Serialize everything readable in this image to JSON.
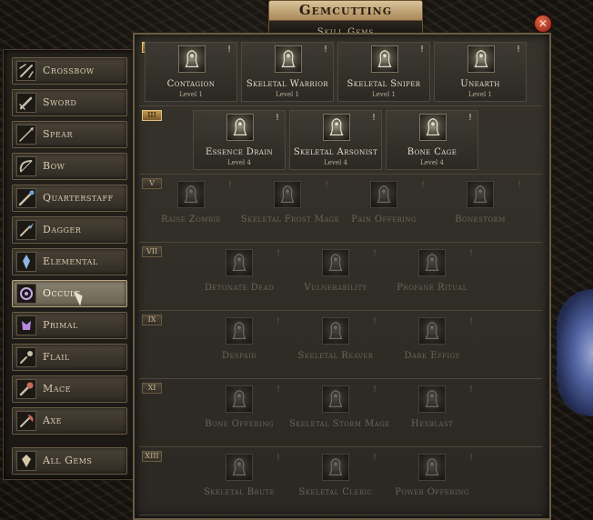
{
  "window": {
    "title": "Gemcutting",
    "subtitle": "Skill Gems",
    "close_symbol": "✕"
  },
  "colors": {
    "accent": "#c59a52",
    "panel": "#37332c",
    "close": "#c13a24",
    "crystal": "#6a7fc4"
  },
  "categories": [
    {
      "label": "Crossbow",
      "icon": "crossbow-icon",
      "active": false
    },
    {
      "label": "Sword",
      "icon": "sword-icon",
      "active": false
    },
    {
      "label": "Spear",
      "icon": "spear-icon",
      "active": false
    },
    {
      "label": "Bow",
      "icon": "bow-icon",
      "active": false
    },
    {
      "label": "Quarterstaff",
      "icon": "quarterstaff-icon",
      "active": false
    },
    {
      "label": "Dagger",
      "icon": "dagger-icon",
      "active": false
    },
    {
      "label": "Elemental",
      "icon": "elemental-icon",
      "active": false
    },
    {
      "label": "Occult",
      "icon": "occult-icon",
      "active": true
    },
    {
      "label": "Primal",
      "icon": "primal-icon",
      "active": false
    },
    {
      "label": "Flail",
      "icon": "flail-icon",
      "active": false
    },
    {
      "label": "Mace",
      "icon": "mace-icon",
      "active": false
    },
    {
      "label": "Axe",
      "icon": "axe-icon",
      "active": false
    }
  ],
  "all_gems": {
    "label": "All Gems",
    "icon": "gem-icon"
  },
  "tiers": [
    {
      "numeral": "I",
      "unlocked": true,
      "gems": [
        {
          "name": "Contagion",
          "level": "Level 1",
          "icon": "contagion-icon"
        },
        {
          "name": "Skeletal Warrior",
          "level": "Level 1",
          "icon": "skeletal-warrior-icon"
        },
        {
          "name": "Skeletal Sniper",
          "level": "Level 1",
          "icon": "skeletal-sniper-icon"
        },
        {
          "name": "Unearth",
          "level": "Level 1",
          "icon": "unearth-icon"
        }
      ]
    },
    {
      "numeral": "III",
      "unlocked": true,
      "gems": [
        {
          "name": "Essence Drain",
          "level": "Level 4",
          "icon": "essence-drain-icon"
        },
        {
          "name": "Skeletal Arsonist",
          "level": "Level 4",
          "icon": "skeletal-arsonist-icon"
        },
        {
          "name": "Bone Cage",
          "level": "Level 4",
          "icon": "bone-cage-icon"
        }
      ]
    },
    {
      "numeral": "V",
      "unlocked": false,
      "gems": [
        {
          "name": "Raise Zombie",
          "level": "",
          "icon": "raise-zombie-icon"
        },
        {
          "name": "Skeletal Frost Mage",
          "level": "",
          "icon": "skeletal-frost-mage-icon"
        },
        {
          "name": "Pain Offering",
          "level": "",
          "icon": "pain-offering-icon"
        },
        {
          "name": "Bonestorm",
          "level": "",
          "icon": "bonestorm-icon"
        }
      ]
    },
    {
      "numeral": "VII",
      "unlocked": false,
      "gems": [
        {
          "name": "Detonate Dead",
          "level": "",
          "icon": "detonate-dead-icon"
        },
        {
          "name": "Vulnerability",
          "level": "",
          "icon": "vulnerability-icon"
        },
        {
          "name": "Profane Ritual",
          "level": "",
          "icon": "profane-ritual-icon"
        }
      ]
    },
    {
      "numeral": "IX",
      "unlocked": false,
      "gems": [
        {
          "name": "Despair",
          "level": "",
          "icon": "despair-icon"
        },
        {
          "name": "Skeletal Reaver",
          "level": "",
          "icon": "skeletal-reaver-icon"
        },
        {
          "name": "Dark Effigy",
          "level": "",
          "icon": "dark-effigy-icon"
        }
      ]
    },
    {
      "numeral": "XI",
      "unlocked": false,
      "gems": [
        {
          "name": "Bone Offering",
          "level": "",
          "icon": "bone-offering-icon"
        },
        {
          "name": "Skeletal Storm Mage",
          "level": "",
          "icon": "skeletal-storm-mage-icon"
        },
        {
          "name": "Hexblast",
          "level": "",
          "icon": "hexblast-icon"
        }
      ]
    },
    {
      "numeral": "XIII",
      "unlocked": false,
      "gems": [
        {
          "name": "Skeletal Brute",
          "level": "",
          "icon": "skeletal-brute-icon"
        },
        {
          "name": "Skeletal Cleric",
          "level": "",
          "icon": "skeletal-cleric-icon"
        },
        {
          "name": "Power Offering",
          "level": "",
          "icon": "power-offering-icon"
        }
      ]
    }
  ],
  "gem_marker": "!"
}
